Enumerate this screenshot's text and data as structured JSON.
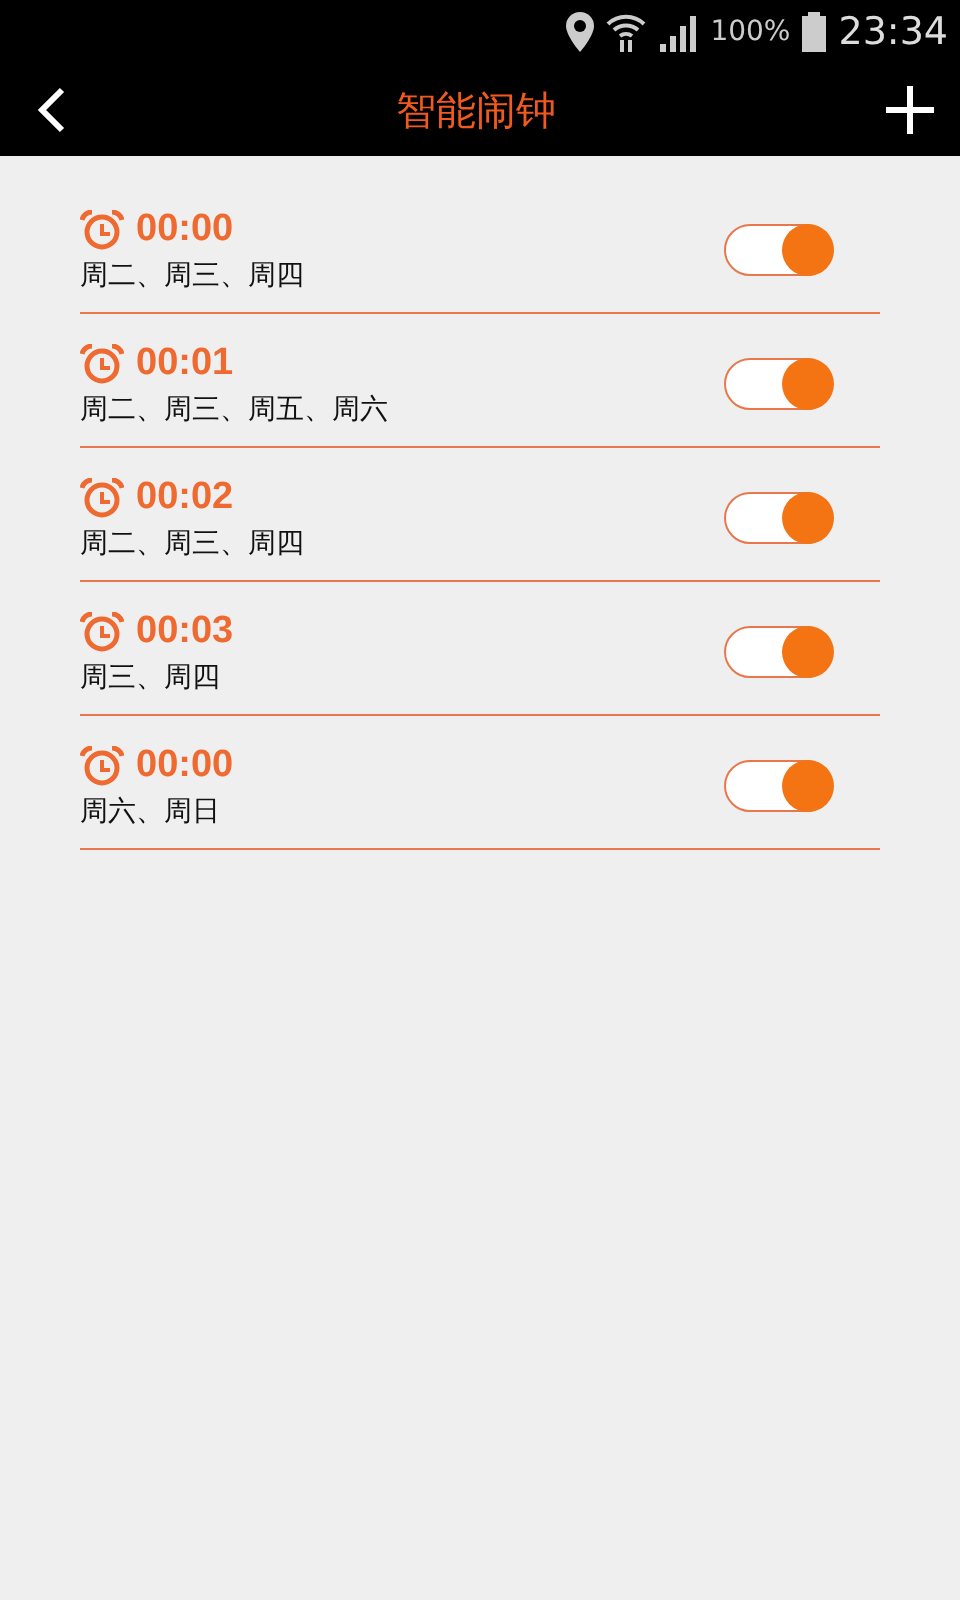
{
  "status_bar": {
    "battery": "100%",
    "time": "23:34"
  },
  "header": {
    "title": "智能闹钟"
  },
  "alarms": [
    {
      "time": "00:00",
      "days": "周二、周三、周四",
      "on": true
    },
    {
      "time": "00:01",
      "days": "周二、周三、周五、周六",
      "on": true
    },
    {
      "time": "00:02",
      "days": "周二、周三、周四",
      "on": true
    },
    {
      "time": "00:03",
      "days": "周三、周四",
      "on": true
    },
    {
      "time": "00:00",
      "days": "周六、周日",
      "on": true
    }
  ]
}
